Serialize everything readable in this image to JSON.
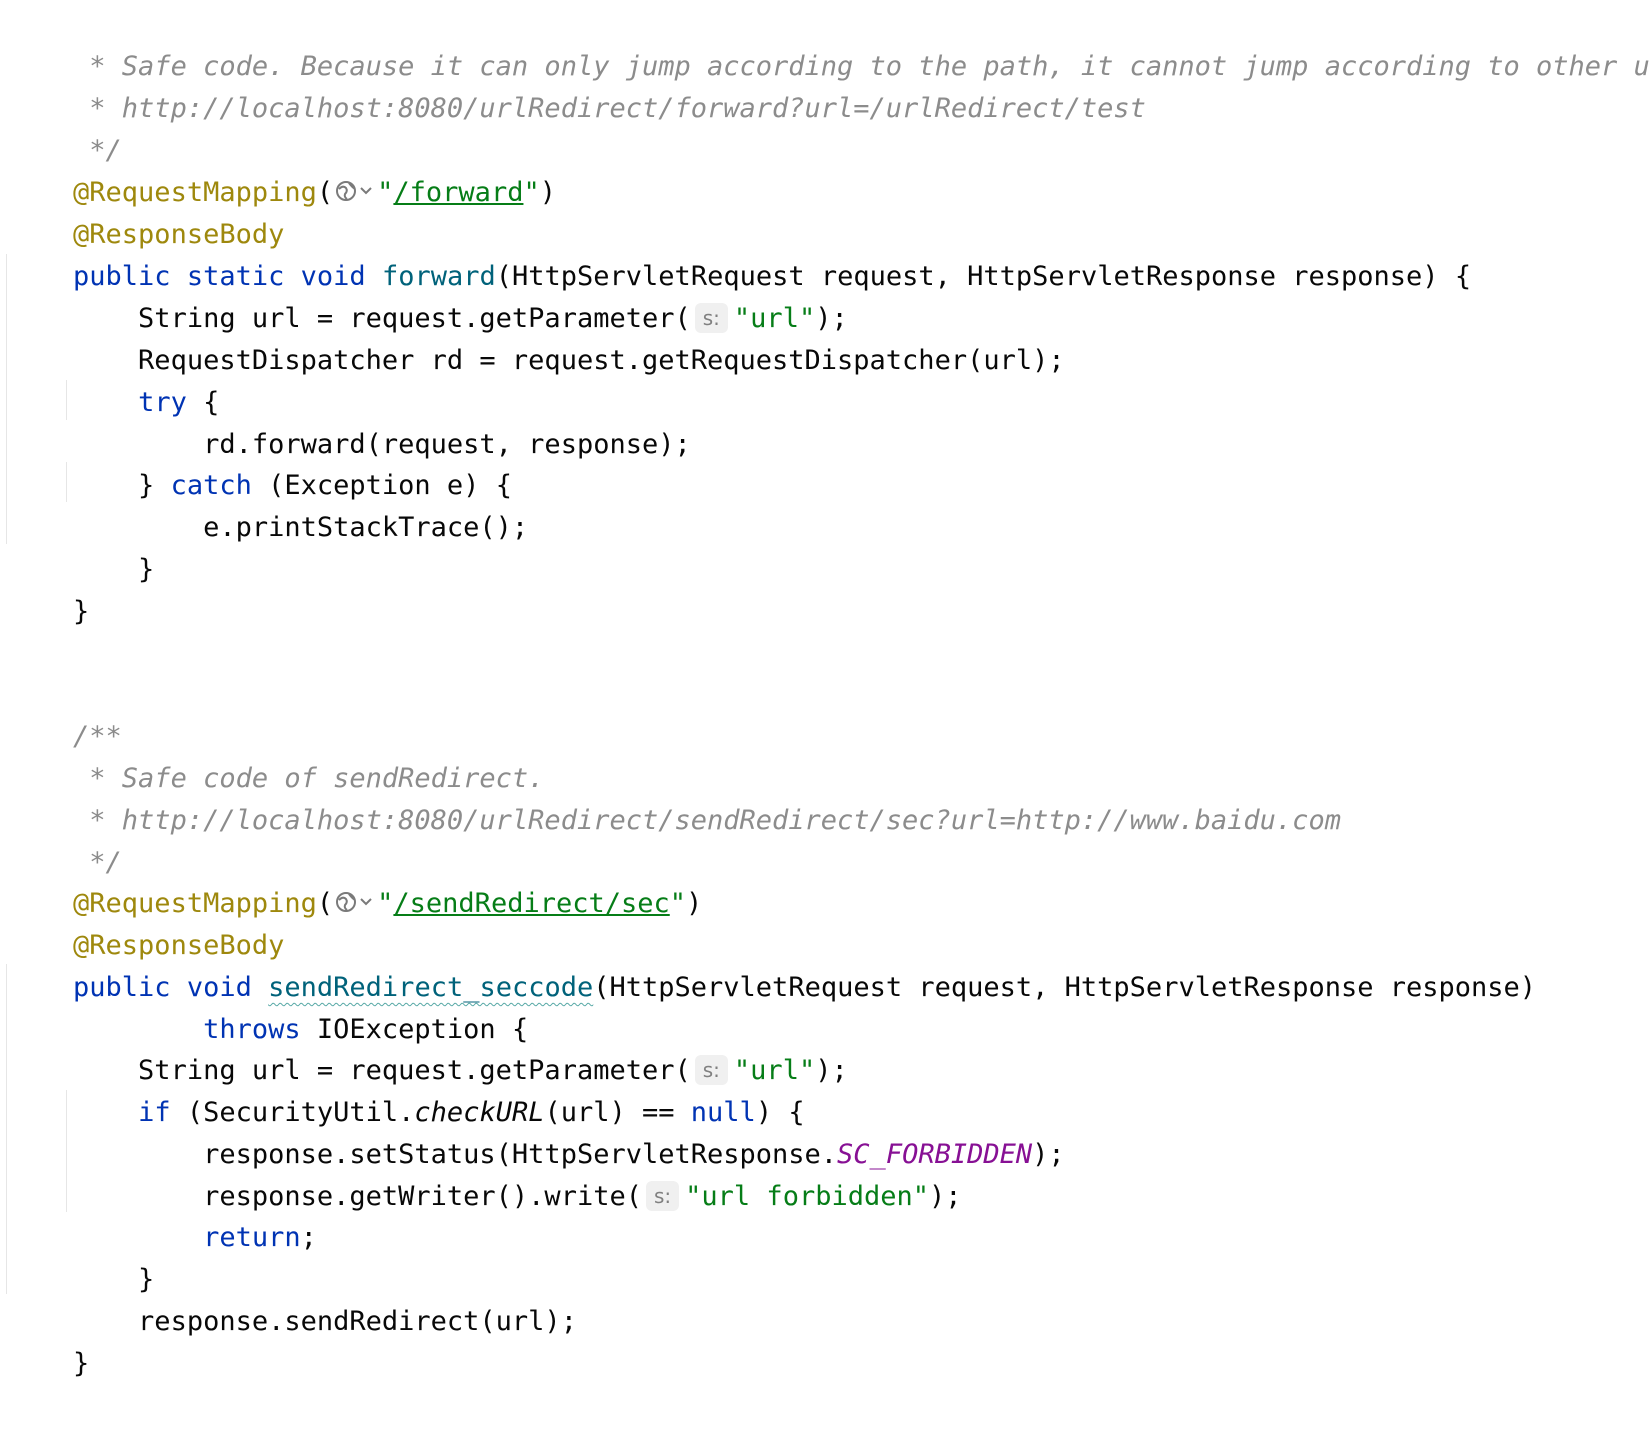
{
  "code": {
    "comment_safe_code": " * Safe code. Because it can only jump according to the path, it cannot jump according to other urls.",
    "comment_url_1": " * http://localhost:8080/urlRedirect/forward?url=/urlRedirect/test",
    "comment_end_1": " */",
    "annotation_request_mapping": "@RequestMapping",
    "paren_open": "(",
    "paren_close": ")",
    "quote": "\"",
    "path_forward": "/forward",
    "annotation_response_body": "@ResponseBody",
    "kw_public": "public",
    "kw_static": "static",
    "kw_void": "void",
    "fn_forward": "forward",
    "forward_params": "(HttpServletRequest request, HttpServletResponse response) {",
    "string_url_decl_a": "    String url = request.getParameter(",
    "hint_s": "s:",
    "str_url": "\"url\"",
    "stmt_end_paren": ");",
    "dispatcher_line": "    RequestDispatcher rd = request.getRequestDispatcher(url);",
    "kw_try": "try",
    "brace_open_sp": " {",
    "rd_forward_line": "        rd.forward(request, response);",
    "close_brace_catch": "    } ",
    "kw_catch": "catch",
    "catch_rest": " (Exception e) {",
    "print_stack_line": "        e.printStackTrace();",
    "inner_close_brace": "    }",
    "outer_close_brace": "}",
    "comment_start_2": "/**",
    "comment_safe_send": " * Safe code of sendRedirect.",
    "comment_url_2": " * http://localhost:8080/urlRedirect/sendRedirect/sec?url=http://www.baidu.com",
    "comment_end_2": " */",
    "path_send_redirect": "/sendRedirect/sec",
    "fn_send_redirect": "sendRedirect_seccode",
    "send_params": "(HttpServletRequest request, HttpServletResponse response)",
    "kw_throws": "throws",
    "throws_rest": " IOException {",
    "kw_if": "if",
    "if_open": " (SecurityUtil.",
    "fn_check_url": "checkURL",
    "if_mid": "(url) == ",
    "kw_null": "null",
    "if_close": ") {",
    "set_status_a": "        response.setStatus(HttpServletResponse.",
    "const_forbidden": "SC_FORBIDDEN",
    "writer_a": "        response.getWriter().write(",
    "str_url_forbidden": "\"url forbidden\"",
    "kw_return": "return",
    "semicolon": ";",
    "send_redirect_line": "    response.sendRedirect(url);",
    "indent_4": "    ",
    "indent_8": "        ",
    "space": " "
  },
  "icons": {
    "globe_dropdown": "globe-dropdown-icon"
  },
  "colors": {
    "comment": "#8c8c8c",
    "annotation": "#9e880d",
    "keyword": "#0033b3",
    "function": "#00627a",
    "string": "#067d17",
    "constant": "#871094"
  }
}
